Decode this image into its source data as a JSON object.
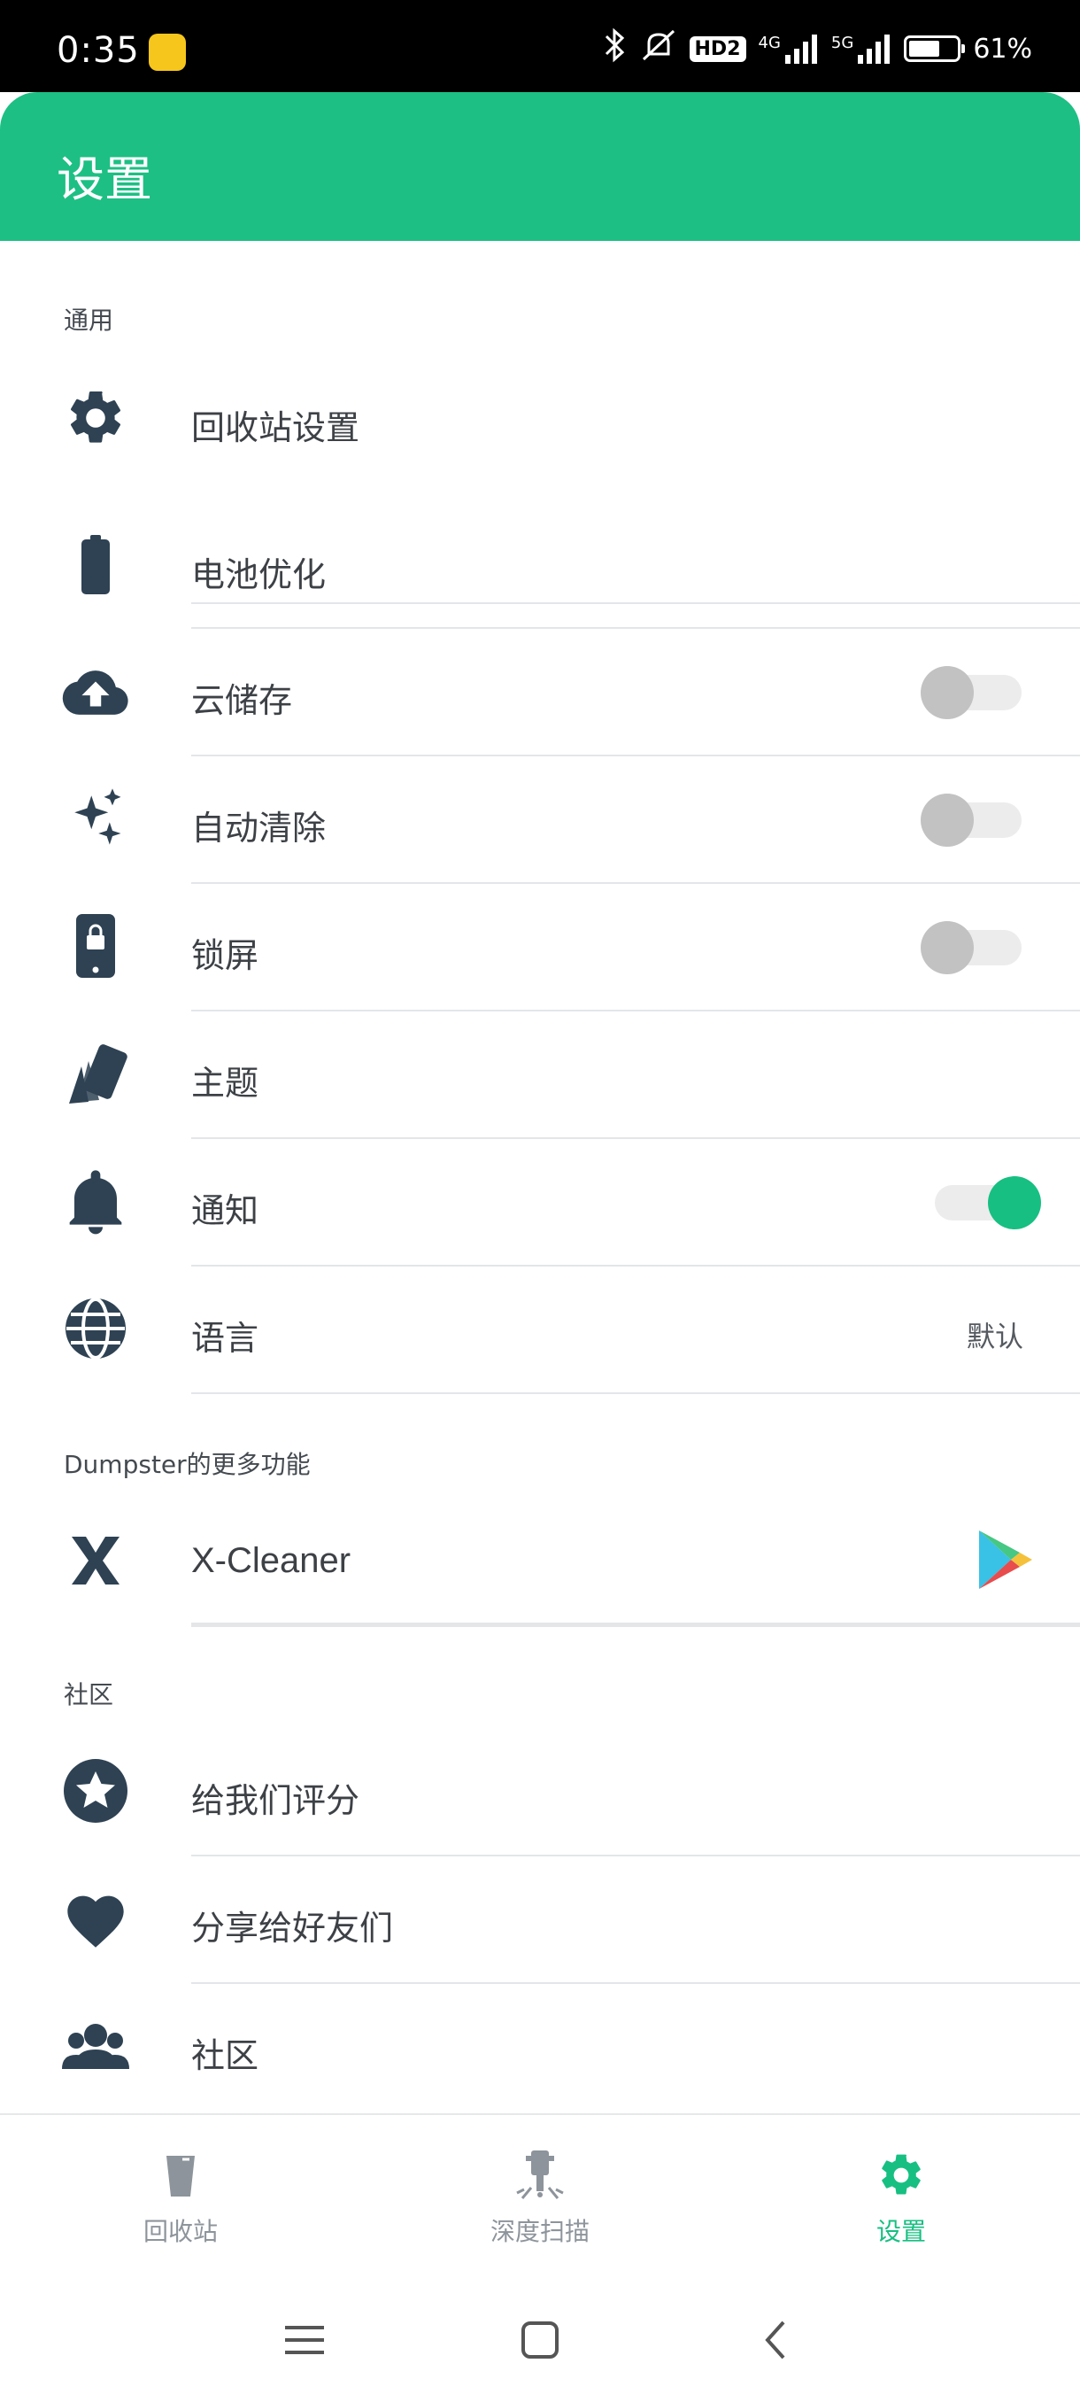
{
  "status_bar": {
    "time": "0:35",
    "hd_badge": "HD2",
    "net1": "4G",
    "net2": "5G",
    "battery_text": "61%",
    "battery_level": 0.61
  },
  "app_bar": {
    "title": "设置"
  },
  "sections": {
    "general": "通用",
    "more": "Dumpster的更多功能",
    "community": "社区"
  },
  "settings": {
    "recycle_settings": {
      "label": "回收站设置",
      "icon": "gear-icon"
    },
    "battery_opt": {
      "label": "电池优化",
      "icon": "battery-icon"
    },
    "cloud_storage": {
      "label": "云储存",
      "icon": "cloud-upload-icon",
      "toggle": false
    },
    "auto_clean": {
      "label": "自动清除",
      "icon": "sparkles-icon",
      "toggle": false
    },
    "lock_screen": {
      "label": "锁屏",
      "icon": "phone-lock-icon",
      "toggle": false
    },
    "theme": {
      "label": "主题",
      "icon": "swatch-icon"
    },
    "notification": {
      "label": "通知",
      "icon": "bell-icon",
      "toggle": true
    },
    "language": {
      "label": "语言",
      "icon": "globe-icon",
      "value": "默认"
    }
  },
  "more": {
    "xcleaner": {
      "label": "X-Cleaner",
      "icon": "x-cleaner-icon",
      "store_icon": "google-play-icon"
    }
  },
  "community": {
    "rate": {
      "label": "给我们评分",
      "icon": "star-badge-icon"
    },
    "share": {
      "label": "分享给好友们",
      "icon": "heart-icon"
    },
    "community": {
      "label": "社区",
      "icon": "people-icon"
    }
  },
  "bottom_nav": [
    {
      "label": "回收站",
      "icon": "trash-icon",
      "active": false
    },
    {
      "label": "深度扫描",
      "icon": "drill-icon",
      "active": false
    },
    {
      "label": "设置",
      "icon": "gear-icon",
      "active": true
    }
  ],
  "colors": {
    "primary": "#1dbf84",
    "icon": "#2e4253",
    "toggle_on": "#17bf82"
  }
}
